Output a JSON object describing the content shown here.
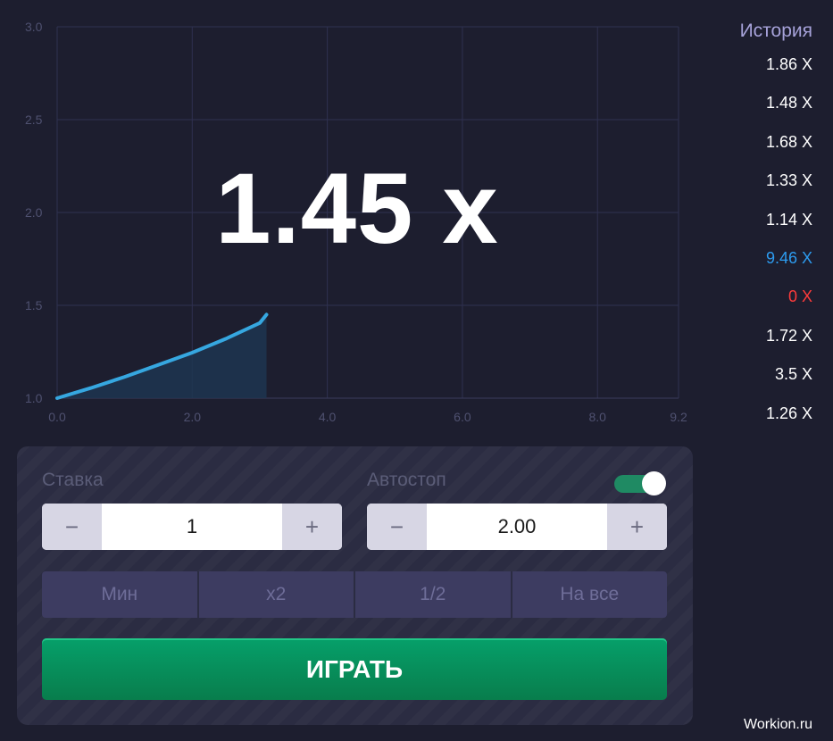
{
  "multiplier": "1.45 x",
  "chart_data": {
    "type": "area",
    "x": [
      0,
      0.5,
      1,
      1.5,
      2,
      2.5,
      3,
      3.1
    ],
    "y": [
      1.0,
      1.055,
      1.115,
      1.18,
      1.245,
      1.32,
      1.405,
      1.45
    ],
    "xlim": [
      0,
      9.2
    ],
    "ylim": [
      1.0,
      3.0
    ],
    "xticks": [
      "0.0",
      "2.0",
      "4.0",
      "6.0",
      "8.0",
      "9.2"
    ],
    "xtick_values": [
      0,
      2,
      4,
      6,
      8,
      9.2
    ],
    "yticks": [
      "1.0",
      "1.5",
      "2.0",
      "2.5",
      "3.0"
    ],
    "ytick_values": [
      1.0,
      1.5,
      2.0,
      2.5,
      3.0
    ],
    "grid": true,
    "line_color": "#36a7e0",
    "fill_color": "#1d3550"
  },
  "history": {
    "title": "История",
    "items": [
      {
        "text": "1.86 X",
        "color": "#ffffff"
      },
      {
        "text": "1.48 X",
        "color": "#ffffff"
      },
      {
        "text": "1.68 X",
        "color": "#ffffff"
      },
      {
        "text": "1.33 X",
        "color": "#ffffff"
      },
      {
        "text": "1.14 X",
        "color": "#ffffff"
      },
      {
        "text": "9.46 X",
        "color": "#2d9cf0"
      },
      {
        "text": "0 X",
        "color": "#ff3b3b"
      },
      {
        "text": "1.72 X",
        "color": "#ffffff"
      },
      {
        "text": "3.5 X",
        "color": "#ffffff"
      },
      {
        "text": "1.26 X",
        "color": "#ffffff"
      }
    ]
  },
  "bet": {
    "label": "Ставка",
    "value": "1",
    "minus": "−",
    "plus": "+"
  },
  "autostop": {
    "label": "Автостоп",
    "value": "2.00",
    "minus": "−",
    "plus": "+",
    "enabled": true
  },
  "quick_buttons": [
    "Мин",
    "x2",
    "1/2",
    "На все"
  ],
  "play_label": "ИГРАТЬ",
  "watermark": "Workion.ru",
  "colors": {
    "background": "#1d1e2f",
    "panel": "#2b2c42",
    "play": "#06a06a",
    "toggle_on": "#1f8a63"
  }
}
